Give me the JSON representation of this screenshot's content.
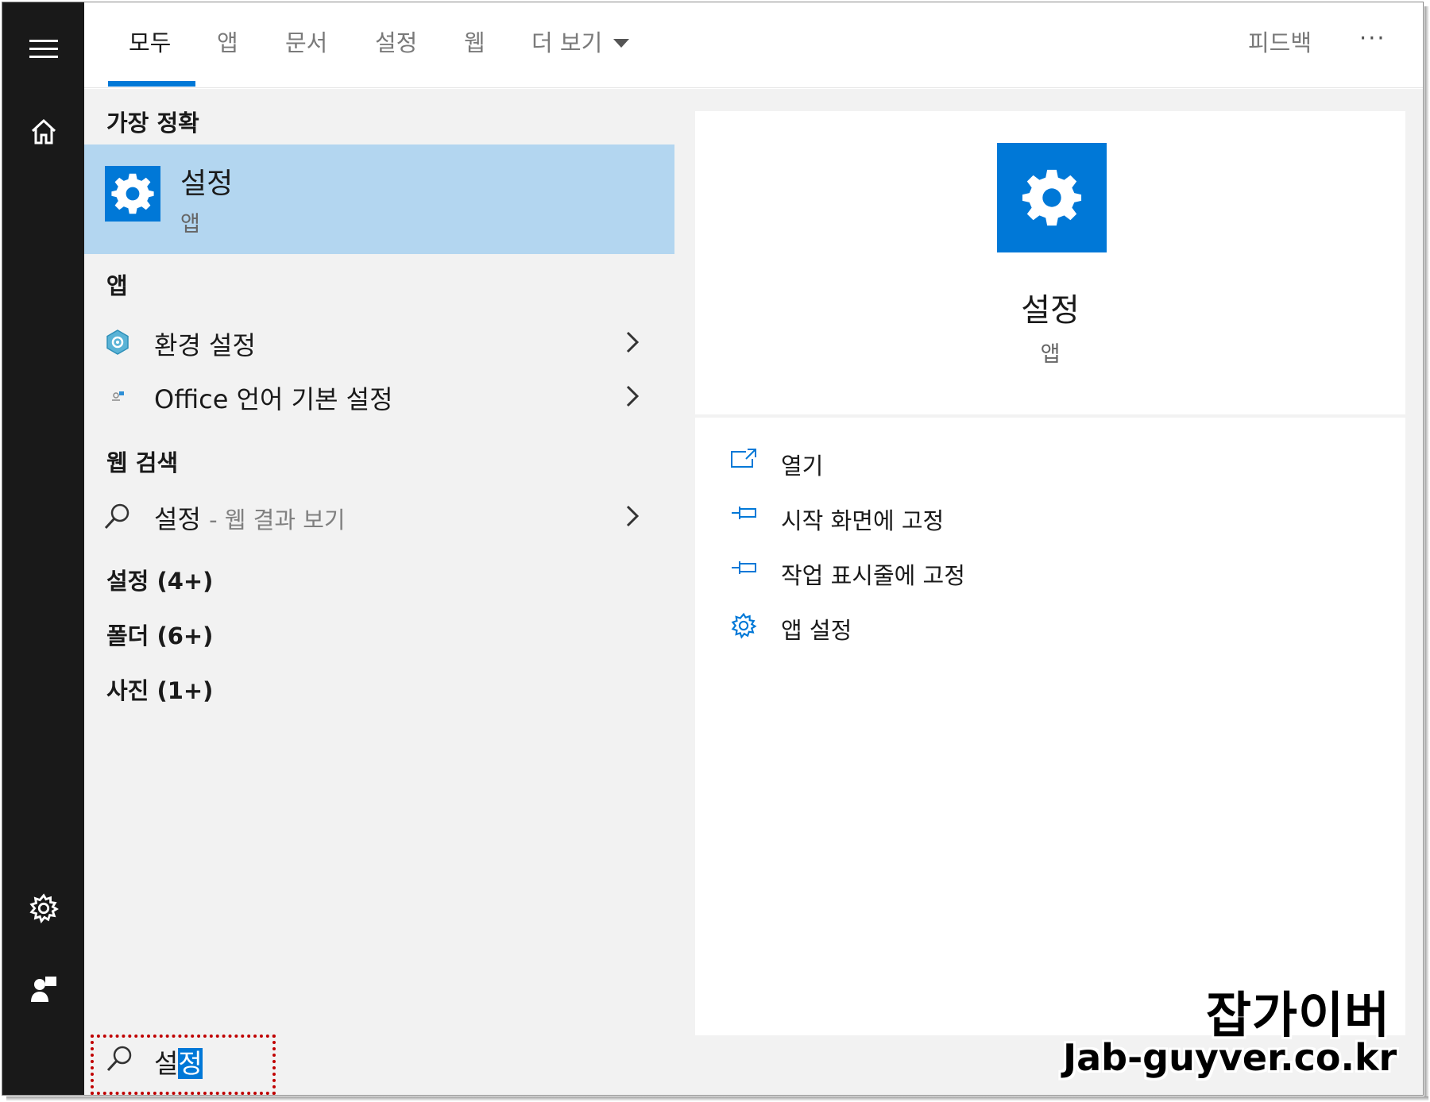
{
  "tabs": [
    {
      "label": "모두",
      "active": true
    },
    {
      "label": "앱"
    },
    {
      "label": "문서"
    },
    {
      "label": "설정"
    },
    {
      "label": "웹"
    },
    {
      "label": "더 보기"
    }
  ],
  "topbar": {
    "feedback": "피드백",
    "more": "···"
  },
  "sidebar": {
    "icons": [
      "hamburger-icon",
      "home-icon",
      "gear-icon",
      "feedback-person-icon"
    ]
  },
  "results": {
    "best_match_header": "가장 정확",
    "best_match": {
      "title": "설정",
      "subtitle": "앱",
      "icon": "gear-icon"
    },
    "apps_header": "앱",
    "apps": [
      {
        "label": "환경 설정",
        "icon": "control-panel-icon"
      },
      {
        "label": "Office 언어 기본 설정",
        "icon": "office-language-icon"
      }
    ],
    "web_header": "웹 검색",
    "web": {
      "query": "설정",
      "suffix": "- 웹 결과 보기",
      "icon": "search-icon"
    },
    "categories": [
      "설정 (4+)",
      "폴더 (6+)",
      "사진 (1+)"
    ]
  },
  "search": {
    "text_plain": "설",
    "text_selected": "정"
  },
  "preview": {
    "title": "설정",
    "subtitle": "앱",
    "actions": [
      {
        "label": "열기",
        "icon": "open-icon"
      },
      {
        "label": "시작 화면에 고정",
        "icon": "pin-icon"
      },
      {
        "label": "작업 표시줄에 고정",
        "icon": "pin-icon"
      },
      {
        "label": "앱 설정",
        "icon": "gear-icon"
      }
    ]
  },
  "watermark": {
    "line1": "잡가이버",
    "line2": "Jab-guyver.co.kr"
  },
  "colors": {
    "accent": "#0078d7",
    "selection": "#b3d6f0",
    "rail": "#191919",
    "highlight_box": "#c00000"
  }
}
